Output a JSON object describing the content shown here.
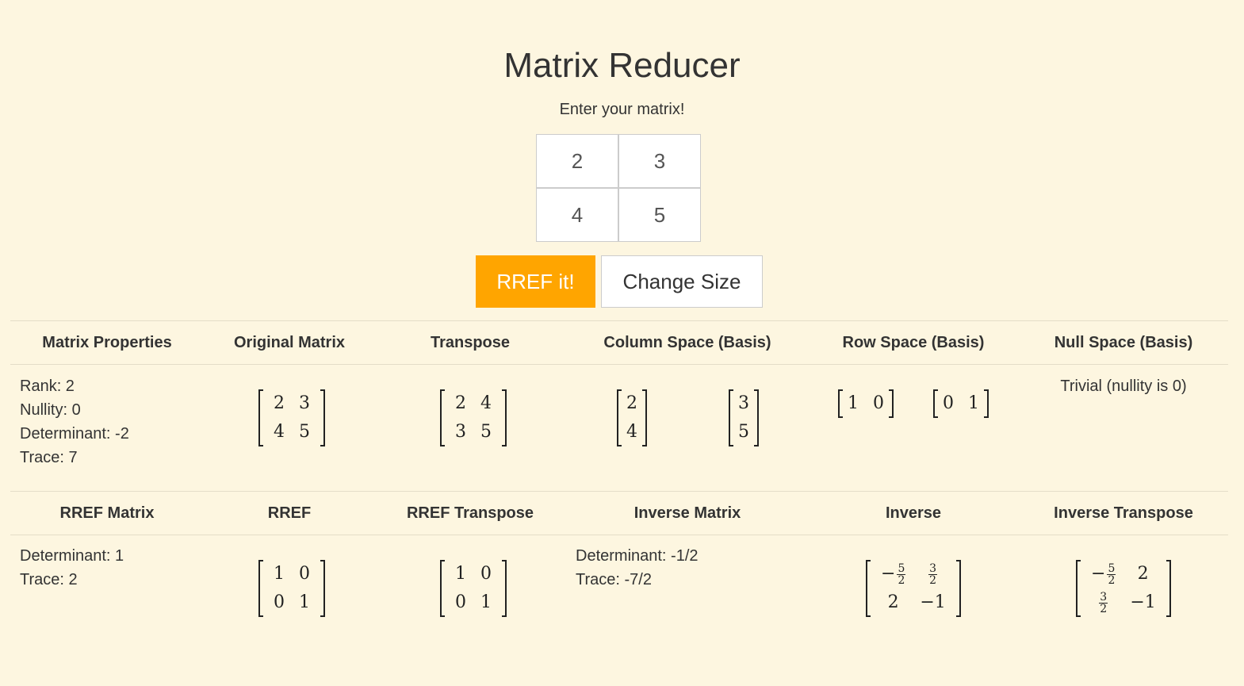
{
  "title": "Matrix Reducer",
  "subtitle": "Enter your matrix!",
  "input_matrix": [
    [
      "2",
      "3"
    ],
    [
      "4",
      "5"
    ]
  ],
  "buttons": {
    "rref": "RREF it!",
    "change_size": "Change Size"
  },
  "colors": {
    "background": "#fdf6e0",
    "accent": "#ffa500"
  },
  "section1": {
    "headers": [
      "Matrix Properties",
      "Original Matrix",
      "Transpose",
      "Column Space (Basis)",
      "Row Space (Basis)",
      "Null Space (Basis)"
    ],
    "properties": [
      "Rank: 2",
      "Nullity: 0",
      "Determinant: -2",
      "Trace: 7"
    ],
    "original": [
      [
        "2",
        "3"
      ],
      [
        "4",
        "5"
      ]
    ],
    "transpose": [
      [
        "2",
        "4"
      ],
      [
        "3",
        "5"
      ]
    ],
    "column_space": [
      [
        [
          "2"
        ],
        [
          "4"
        ]
      ],
      [
        [
          "3"
        ],
        [
          "5"
        ]
      ]
    ],
    "row_space": [
      [
        [
          "1",
          "0"
        ]
      ],
      [
        [
          "0",
          "1"
        ]
      ]
    ],
    "null_space": "Trivial (nullity is 0)"
  },
  "section2": {
    "headers": [
      "RREF Matrix",
      "RREF",
      "RREF Transpose",
      "Inverse Matrix",
      "Inverse",
      "Inverse Transpose"
    ],
    "rref_properties": [
      "Determinant: 1",
      "Trace: 2"
    ],
    "rref": [
      [
        "1",
        "0"
      ],
      [
        "0",
        "1"
      ]
    ],
    "rref_transpose": [
      [
        "1",
        "0"
      ],
      [
        "0",
        "1"
      ]
    ],
    "inverse_properties": [
      "Determinant: -1/2",
      "Trace: -7/2"
    ],
    "inverse": [
      [
        "-5/2",
        "3/2"
      ],
      [
        "2",
        "-1"
      ]
    ],
    "inverse_transpose": [
      [
        "-5/2",
        "2"
      ],
      [
        "3/2",
        "-1"
      ]
    ]
  }
}
